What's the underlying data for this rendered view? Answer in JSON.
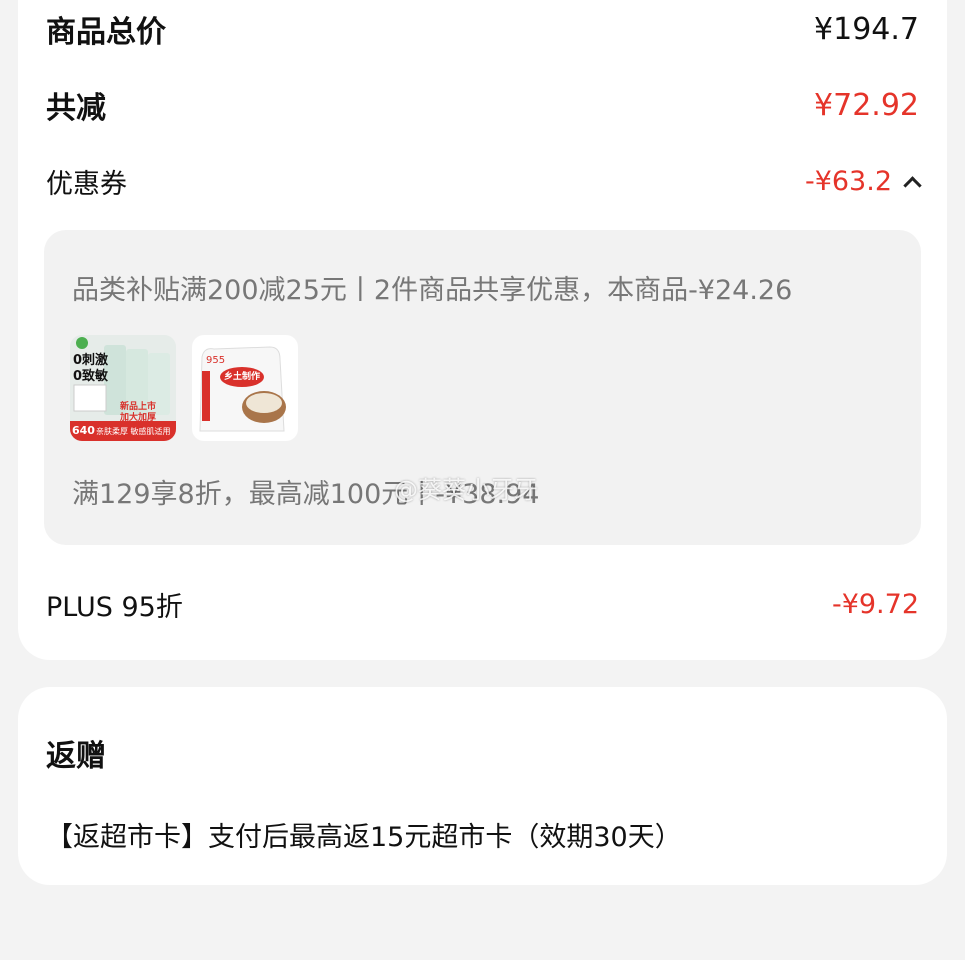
{
  "summary": {
    "total_label": "商品总价",
    "total_value": "¥194.7",
    "reduce_label": "共减",
    "reduce_value": "¥72.92",
    "coupon_label": "优惠券",
    "coupon_value": "-¥63.2",
    "plus_label": "PLUS 95折",
    "plus_value": "-¥9.72"
  },
  "coupon_detail": {
    "line1": "品类补贴满200减25元丨2件商品共享优惠，本商品-¥24.26",
    "line2": "满129享8折，最高减100元丨-¥38.94",
    "watermark": "@葵葵小牙牙",
    "products": [
      {
        "name": "wipes-pack",
        "text_lines": [
          "0刺激",
          "0致敏"
        ],
        "badge": "640",
        "footer": "亲肤柔厚 敏感肌适用",
        "side_text": [
          "新品上市",
          "加大加厚"
        ]
      },
      {
        "name": "rice-bag",
        "brand_label": "乡土制作",
        "side_text": "955"
      }
    ]
  },
  "gift": {
    "title": "返赠",
    "desc": "【返超市卡】支付后最高返15元超市卡（效期30天）"
  },
  "colors": {
    "accent_red": "#e5342a",
    "background": "#f3f3f3",
    "card": "#ffffff",
    "panel": "#f2f2f2"
  },
  "icons": {
    "coupon_toggle": "chevron-up-icon"
  }
}
